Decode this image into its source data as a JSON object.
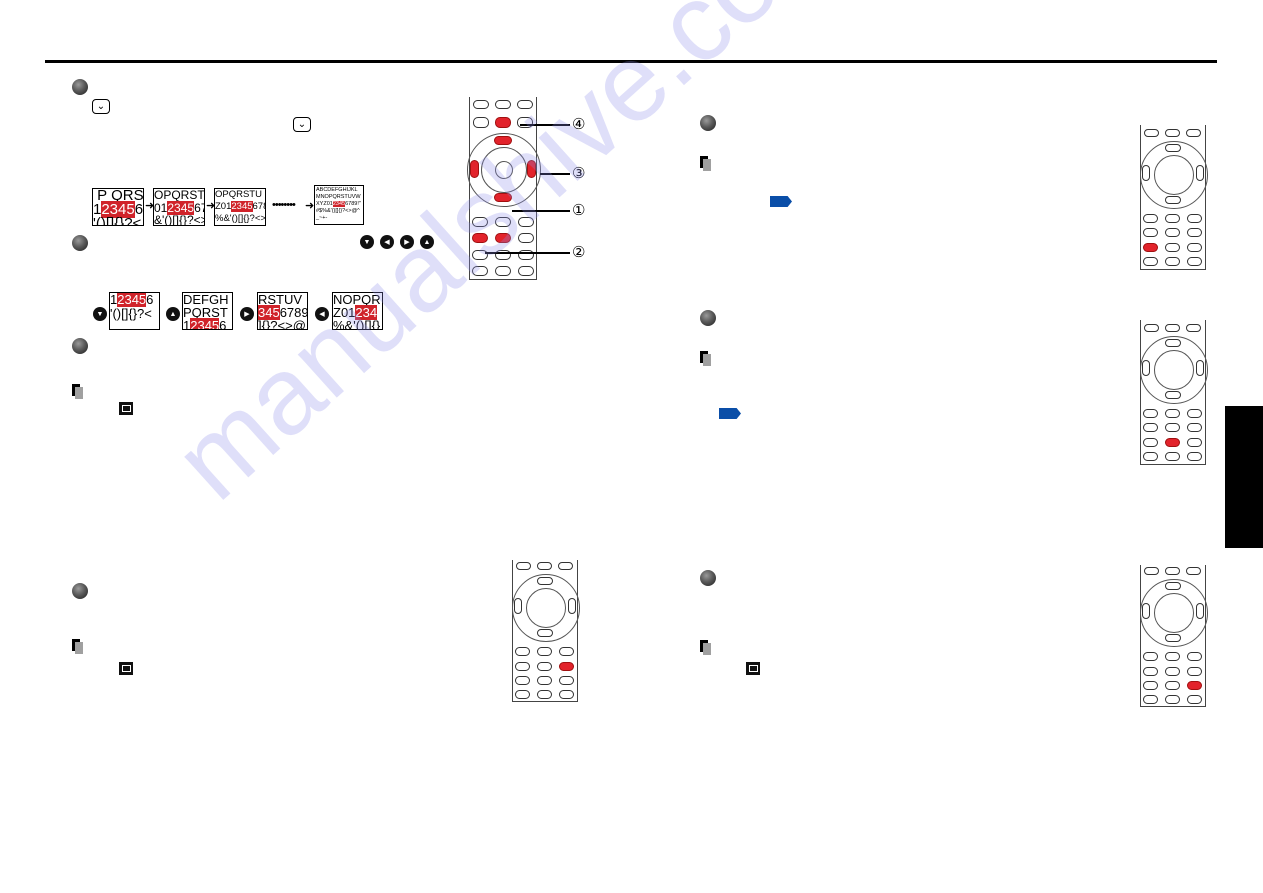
{
  "page": {
    "watermark_text": "manualshive.com",
    "accent_red": "#d0232a",
    "reference_blue": "#0a4ea8"
  },
  "left_column": {
    "step1": {
      "key_icon": "down-key-icon",
      "key_glyph": "⌄",
      "zoom_sequence": [
        {
          "lines": [
            "P QRST",
            "12345 6",
            "'()[]{}?<"
          ],
          "highlight": "2345"
        },
        {
          "lines": [
            "OPQRSTU",
            "012345 67",
            "&'()[]{}?<>"
          ],
          "highlight": "2345"
        },
        {
          "lines": [
            "OPQRSTU",
            "Z012345 678",
            "%&'()[]{}?<>"
          ],
          "highlight": "2345"
        },
        {
          "lines": [
            "ABCDEFGHIJKL",
            "MNOPQRSTUVW",
            "XYZ01 2345 6789!\"",
            "#$%&'()[]{}?<>@^\\",
            "_~+-"
          ],
          "highlight": "2345"
        }
      ],
      "arrow_glyph": "➜",
      "dots_glyph": "••••••••"
    },
    "step2": {
      "direction_keys": [
        {
          "name": "down",
          "glyph": "▼"
        },
        {
          "name": "left",
          "glyph": "◀"
        },
        {
          "name": "right",
          "glyph": "▶"
        },
        {
          "name": "up",
          "glyph": "▲"
        }
      ],
      "pan_examples": [
        {
          "key": "▼",
          "lines": [
            "12345 6",
            "'()[]{}?<"
          ],
          "highlight": "2345"
        },
        {
          "key": "▲",
          "lines": [
            "DEFGH",
            "PQRST",
            "12345 6"
          ],
          "highlight": "2345"
        },
        {
          "key": "▶",
          "lines": [
            "RSTUV",
            "3456789",
            "]{}?<>@"
          ],
          "highlight": "345"
        },
        {
          "key": "◀",
          "lines": [
            "NOPQR",
            "Z01 234",
            "%&'()[]{}"
          ],
          "highlight": "234"
        }
      ]
    },
    "remote1_callouts": [
      "④",
      "③",
      "①",
      "②"
    ]
  },
  "right_column": {
    "sections": [
      {
        "id": "picture",
        "highlight_button": "picture"
      },
      {
        "id": "screen-size",
        "highlight_button": "screen-size"
      },
      {
        "id": "freeze",
        "highlight_button": "freeze"
      }
    ]
  },
  "lower_left": {
    "highlight_button": "mute"
  }
}
